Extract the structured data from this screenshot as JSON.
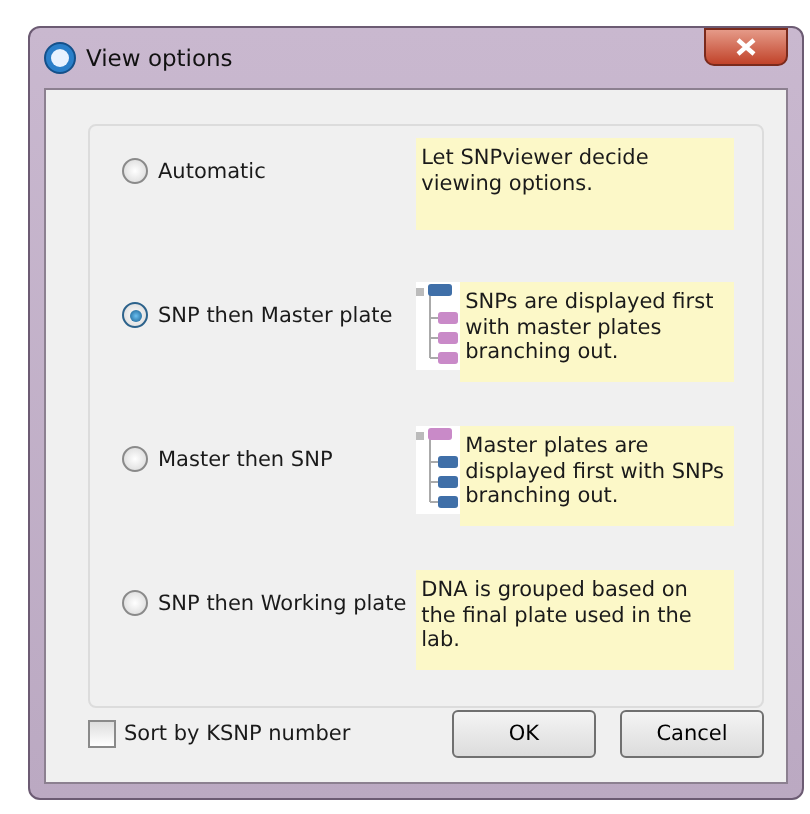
{
  "window": {
    "title": "View options"
  },
  "options": [
    {
      "label": "Automatic",
      "selected": false,
      "kind": "text",
      "description": "Let SNPviewer decide viewing options."
    },
    {
      "label": "SNP then Master plate",
      "selected": true,
      "kind": "tree-snp",
      "description": "SNPs are displayed first with master plates branching out."
    },
    {
      "label": "Master then SNP",
      "selected": false,
      "kind": "tree-master",
      "description": "Master plates are displayed first with SNPs branching out."
    },
    {
      "label": "SNP then Working plate",
      "selected": false,
      "kind": "text",
      "description": "DNA is grouped based on the final plate used in the lab."
    }
  ],
  "sort_checkbox": {
    "label": "Sort by KSNP number",
    "checked": false
  },
  "buttons": [
    "OK",
    "Cancel"
  ]
}
